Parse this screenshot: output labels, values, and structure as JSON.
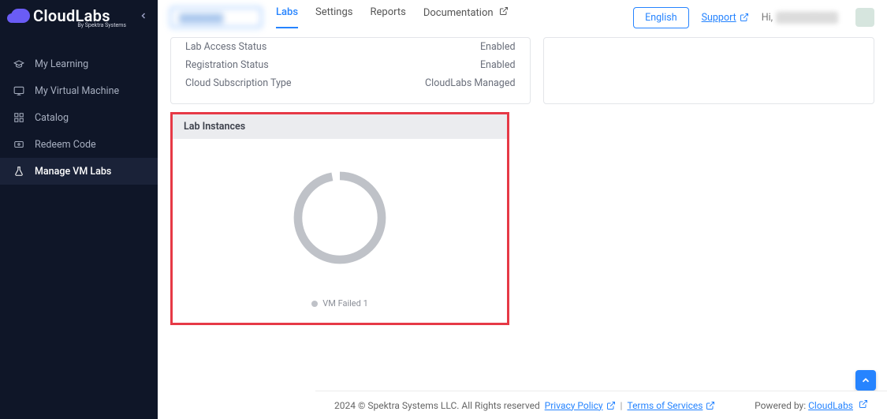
{
  "brand": {
    "name": "CloudLabs",
    "by": "By Spektra Systems"
  },
  "sidebar": {
    "items": [
      {
        "label": "My Learning",
        "icon": "graduation-cap-icon"
      },
      {
        "label": "My Virtual Machine",
        "icon": "monitor-icon"
      },
      {
        "label": "Catalog",
        "icon": "grid-icon"
      },
      {
        "label": "Redeem Code",
        "icon": "ticket-icon"
      },
      {
        "label": "Manage VM Labs",
        "icon": "flask-icon"
      }
    ],
    "active_index": 4
  },
  "topnav": {
    "items": [
      {
        "label": "Labs"
      },
      {
        "label": "Settings"
      },
      {
        "label": "Reports"
      },
      {
        "label": "Documentation",
        "external": true
      }
    ],
    "active_index": 0
  },
  "header_right": {
    "language": "English",
    "support": "Support",
    "greeting": "Hi,",
    "user_name": "████████"
  },
  "details": {
    "rows": [
      {
        "label": "Lab Access Status",
        "value": "Enabled"
      },
      {
        "label": "Registration Status",
        "value": "Enabled"
      },
      {
        "label": "Cloud Subscription Type",
        "value": "CloudLabs Managed"
      }
    ]
  },
  "lab_instances": {
    "title": "Lab Instances",
    "legend": "VM Failed 1"
  },
  "chart_data": {
    "type": "pie",
    "title": "Lab Instances",
    "series": [
      {
        "name": "VM Failed",
        "value": 1,
        "color": "#bfc2c8"
      }
    ],
    "total": 1
  },
  "footer": {
    "copyright": "2024 © Spektra Systems LLC. All Rights reserved",
    "privacy": "Privacy Policy",
    "terms": "Terms of Services",
    "powered_label": "Powered by:",
    "powered_link": "CloudLabs"
  }
}
